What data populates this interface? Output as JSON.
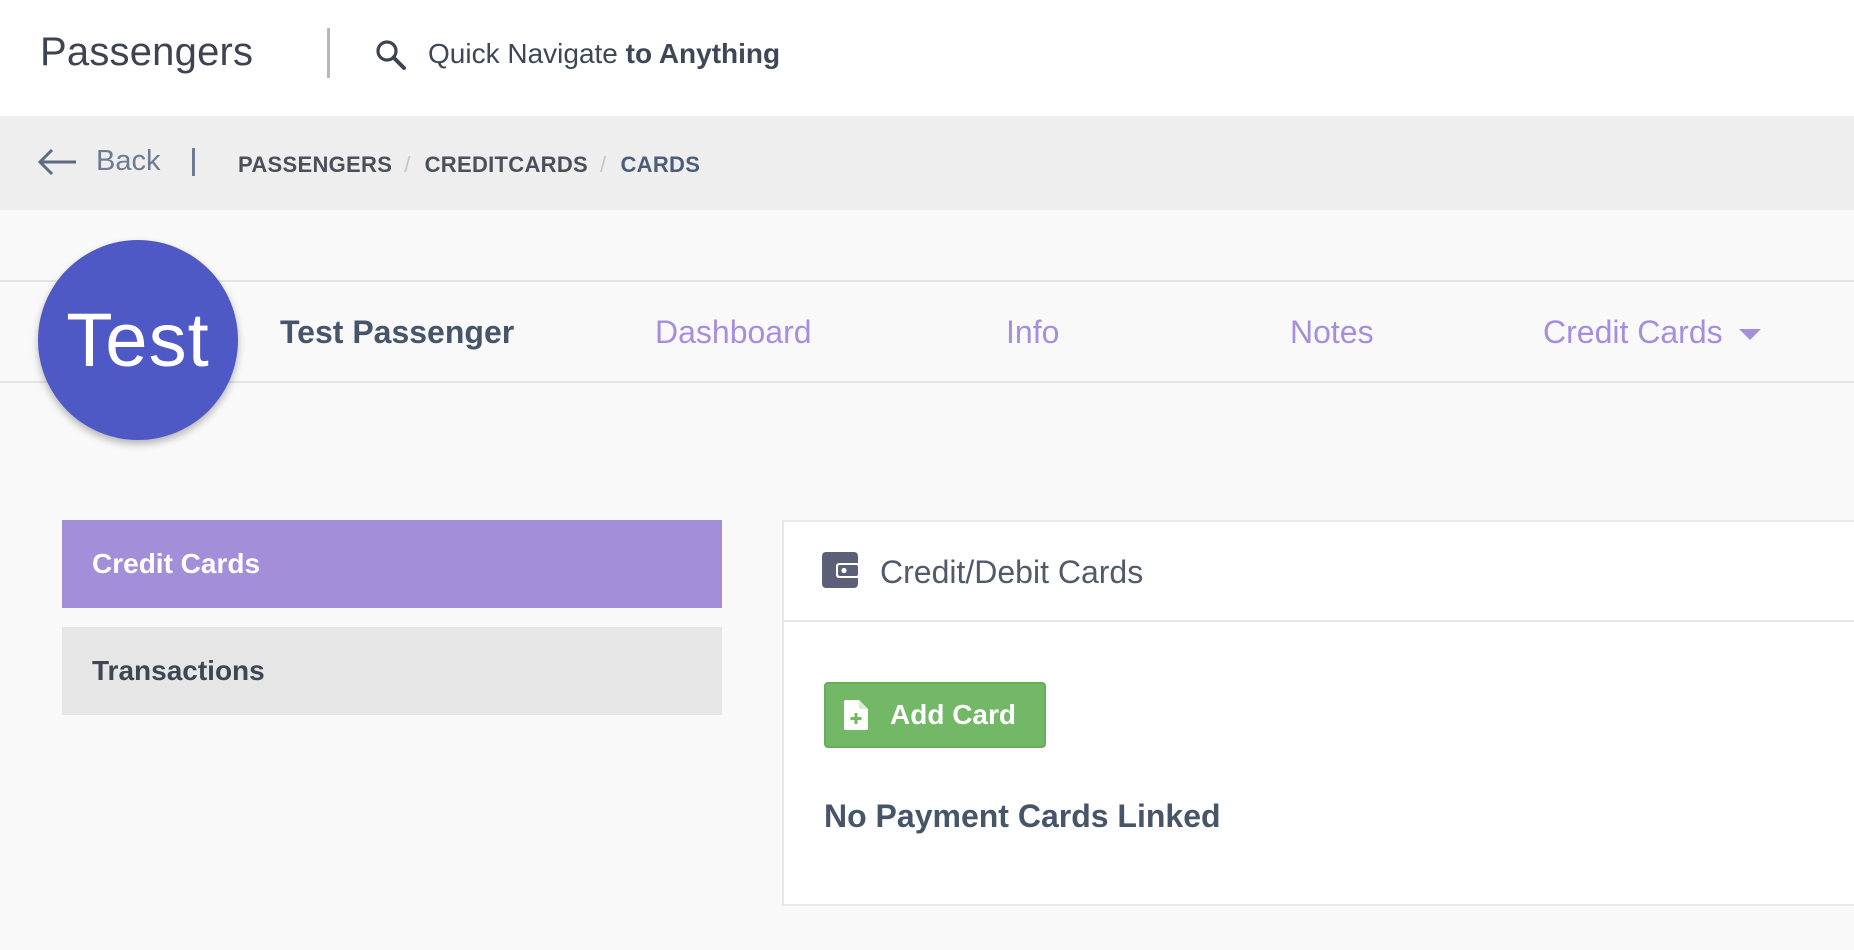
{
  "header": {
    "app_title": "Passengers",
    "quick_nav_prefix": "Quick Navigate",
    "quick_nav_emphasis": "to Anything"
  },
  "breadcrumb_bar": {
    "back_label": "Back",
    "crumbs": [
      "PASSENGERS",
      "CREDITCARDS",
      "CARDS"
    ]
  },
  "profile": {
    "avatar_text": "Test",
    "name": "Test Passenger",
    "avatar_color": "#4e59c6"
  },
  "nav": {
    "tabs": [
      "Dashboard",
      "Info",
      "Notes",
      "Credit Cards"
    ],
    "accent_color": "#a58fdc"
  },
  "sidebar": {
    "items": [
      "Credit Cards",
      "Transactions"
    ],
    "active_color": "#a38ed9"
  },
  "panel": {
    "title": "Credit/Debit Cards",
    "add_button_label": "Add Card",
    "empty_message": "No Payment Cards Linked",
    "button_color": "#72b866"
  },
  "icons": {
    "search": "search-icon",
    "back": "arrow-left-icon",
    "caret": "caret-down-icon",
    "wallet": "wallet-icon",
    "file_add": "file-plus-icon"
  }
}
